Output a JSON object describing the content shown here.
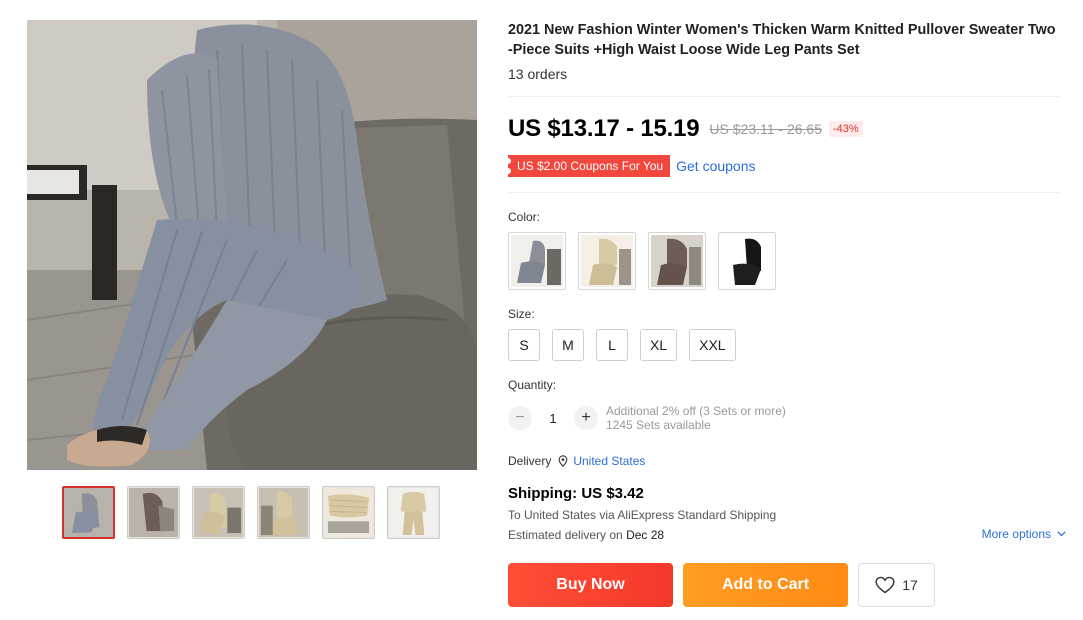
{
  "product": {
    "title": "2021 New Fashion Winter Women's Thicken Warm Knitted Pullover Sweater Two-Piece Suits +High Waist Loose Wide Leg Pants Set",
    "orders": "13 orders"
  },
  "price": {
    "current": "US $13.17 - 15.19",
    "original": "US $23.11 - 26.65",
    "discount": "-43%"
  },
  "coupon": {
    "badge": "US $2.00 Coupons For You",
    "link": "Get coupons"
  },
  "color": {
    "label": "Color:",
    "options": [
      {
        "name": "grey",
        "hex": "#8a8f98"
      },
      {
        "name": "beige",
        "hex": "#d8caa4"
      },
      {
        "name": "coffee",
        "hex": "#6e5d54"
      },
      {
        "name": "black",
        "hex": "#161616"
      }
    ]
  },
  "size": {
    "label": "Size:",
    "options": [
      "S",
      "M",
      "L",
      "XL",
      "XXL"
    ]
  },
  "quantity": {
    "label": "Quantity:",
    "minus": "−",
    "value": "1",
    "plus": "+",
    "discount_note": "Additional 2% off (3 Sets or more)",
    "available": "1245 Sets available"
  },
  "delivery": {
    "label": "Delivery",
    "icon": "location-pin-icon",
    "country": "United States"
  },
  "shipping": {
    "title": "Shipping: US $3.42",
    "route": "To United States via AliExpress Standard Shipping",
    "estimate_prefix": "Estimated delivery on",
    "estimate_date": "Dec 28",
    "more_options": "More options"
  },
  "actions": {
    "buy_now": "Buy Now",
    "add_to_cart": "Add to Cart",
    "wishlist_count": "17"
  },
  "colors": {
    "accent_red": "#f1473e",
    "buy_now": "#f4392b",
    "add_to_cart": "#ff8a14",
    "link": "#2e6dd6"
  }
}
